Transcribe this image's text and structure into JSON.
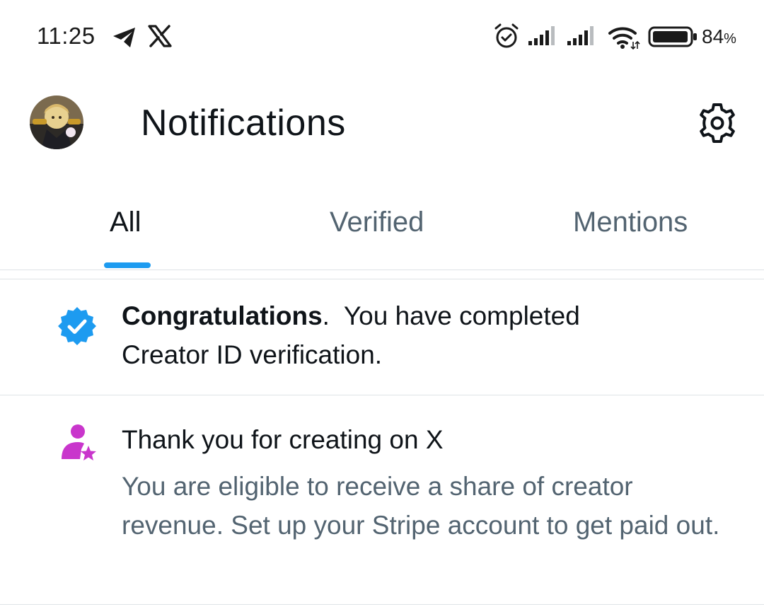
{
  "status_bar": {
    "time": "11:25",
    "battery_percent": "84",
    "battery_percent_sign": "%",
    "icons": [
      "telegram-icon",
      "x-logo-icon",
      "alarm-icon",
      "signal-icon",
      "signal-icon",
      "wifi-icon",
      "battery-icon"
    ]
  },
  "header": {
    "title": "Notifications",
    "avatar": "profile-avatar",
    "settings_icon": "gear-icon"
  },
  "tabs": [
    {
      "label": "All",
      "active": true
    },
    {
      "label": "Verified",
      "active": false
    },
    {
      "label": "Mentions",
      "active": false
    }
  ],
  "notifications": [
    {
      "icon": "verified-badge-icon",
      "bold": "Congratulations",
      "punct": ".",
      "text_line1": "You have completed",
      "text_line2": "Creator ID verification."
    },
    {
      "icon": "creator-star-icon",
      "title": "Thank you for creating on X",
      "body": "You are eligible to receive a share of creator revenue. Set up your Stripe account to get paid out."
    }
  ],
  "colors": {
    "accent": "#1d9bf0",
    "creator_icon": "#c936cc",
    "text_primary": "#0f1419",
    "text_secondary": "#536471",
    "divider": "#dfe3e6"
  }
}
